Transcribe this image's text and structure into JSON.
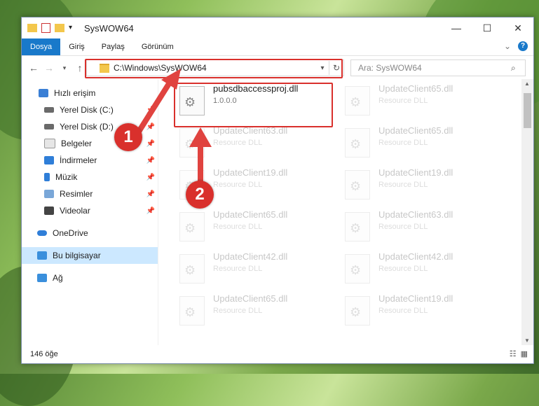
{
  "window": {
    "title": "SysWOW64"
  },
  "ribbon": {
    "tabs": [
      "Dosya",
      "Giriş",
      "Paylaş",
      "Görünüm"
    ],
    "help": "?"
  },
  "address": {
    "path": "C:\\Windows\\SysWOW64"
  },
  "search": {
    "placeholder": "Ara: SysWOW64"
  },
  "sidebar": {
    "items": [
      {
        "label": "Hızlı erişim",
        "icon": "star-icon"
      },
      {
        "label": "Yerel Disk (C:)",
        "icon": "drive-icon"
      },
      {
        "label": "Yerel Disk (D:)",
        "icon": "drive-icon"
      },
      {
        "label": "Belgeler",
        "icon": "documents-icon"
      },
      {
        "label": "İndirmeler",
        "icon": "download-icon"
      },
      {
        "label": "Müzik",
        "icon": "music-icon"
      },
      {
        "label": "Resimler",
        "icon": "pictures-icon"
      },
      {
        "label": "Videolar",
        "icon": "video-icon"
      },
      {
        "label": "OneDrive",
        "icon": "cloud-icon"
      },
      {
        "label": "Bu bilgisayar",
        "icon": "computer-icon"
      },
      {
        "label": "Ağ",
        "icon": "network-icon"
      }
    ]
  },
  "files": [
    {
      "name": "pubsdbaccessproj.dll",
      "sub": "1.0.0.0"
    },
    {
      "name": "UpdateClient65.dll",
      "sub": "Resource DLL"
    },
    {
      "name": "UpdateClient63.dll",
      "sub": "Resource DLL"
    },
    {
      "name": "UpdateClient65.dll",
      "sub": "Resource DLL"
    },
    {
      "name": "UpdateClient19.dll",
      "sub": "Resource DLL"
    },
    {
      "name": "UpdateClient19.dll",
      "sub": "Resource DLL"
    },
    {
      "name": "UpdateClient65.dll",
      "sub": "Resource DLL"
    },
    {
      "name": "UpdateClient63.dll",
      "sub": "Resource DLL"
    },
    {
      "name": "UpdateClient42.dll",
      "sub": "Resource DLL"
    },
    {
      "name": "UpdateClient42.dll",
      "sub": "Resource DLL"
    },
    {
      "name": "UpdateClient65.dll",
      "sub": "Resource DLL"
    },
    {
      "name": "UpdateClient19.dll",
      "sub": "Resource DLL"
    }
  ],
  "status": {
    "count": "146 öğe"
  },
  "annotations": {
    "step1": "1",
    "step2": "2"
  }
}
